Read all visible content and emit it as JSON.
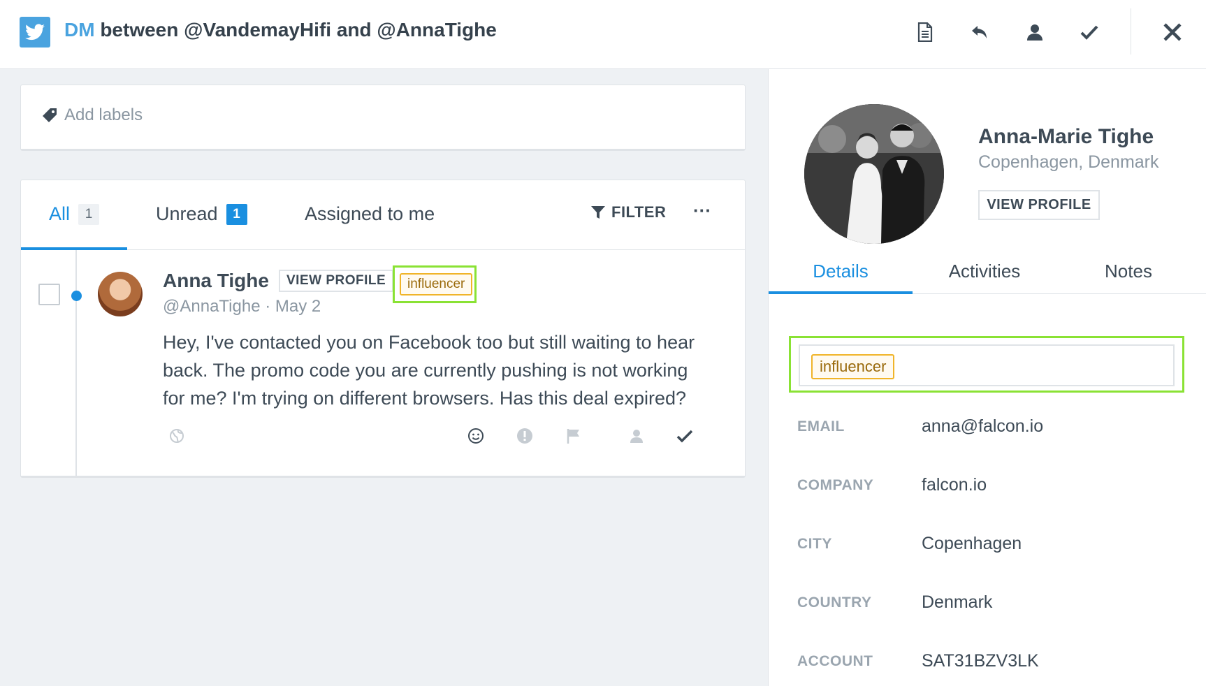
{
  "header": {
    "network_icon": "twitter-icon",
    "title_prefix": "DM",
    "title_rest": "between @VandemayHifi and @AnnaTighe",
    "actions": [
      "document-icon",
      "reply-icon",
      "assign-user-icon",
      "check-icon"
    ],
    "close_icon": "close-icon"
  },
  "labels": {
    "icon": "tag-icon",
    "placeholder": "Add labels"
  },
  "inbox": {
    "tabs": [
      {
        "label": "All",
        "count": "1"
      },
      {
        "label": "Unread",
        "count": "1"
      },
      {
        "label": "Assigned to me"
      }
    ],
    "filter_label": "FILTER",
    "more_label": "···",
    "message": {
      "author": "Anna Tighe",
      "view_profile": "VIEW PROFILE",
      "tag": "influencer",
      "handle": "@AnnaTighe",
      "date": "May 2",
      "text": "Hey, I've contacted you on Facebook too but still waiting to hear back. The promo code you are currently pushing is not working for me? I'm trying on different browsers. Has this deal expired?",
      "actions": [
        "globe-icon",
        "smiley-icon",
        "alert-icon",
        "flag-icon",
        "user-icon",
        "check-icon"
      ]
    }
  },
  "profile": {
    "name": "Anna-Marie Tighe",
    "location": "Copenhagen, Denmark",
    "view_profile": "VIEW PROFILE",
    "tabs": [
      "Details",
      "Activities",
      "Notes"
    ],
    "tag": "influencer",
    "details": [
      {
        "key": "EMAIL",
        "value": "anna@falcon.io"
      },
      {
        "key": "COMPANY",
        "value": "falcon.io"
      },
      {
        "key": "CITY",
        "value": "Copenhagen"
      },
      {
        "key": "COUNTRY",
        "value": "Denmark"
      },
      {
        "key": "ACCOUNT",
        "value": "SAT31BZV3LK"
      }
    ]
  },
  "colors": {
    "accent": "#1a8fe0",
    "highlight": "#8ae234",
    "tag_border": "#f0b429"
  }
}
